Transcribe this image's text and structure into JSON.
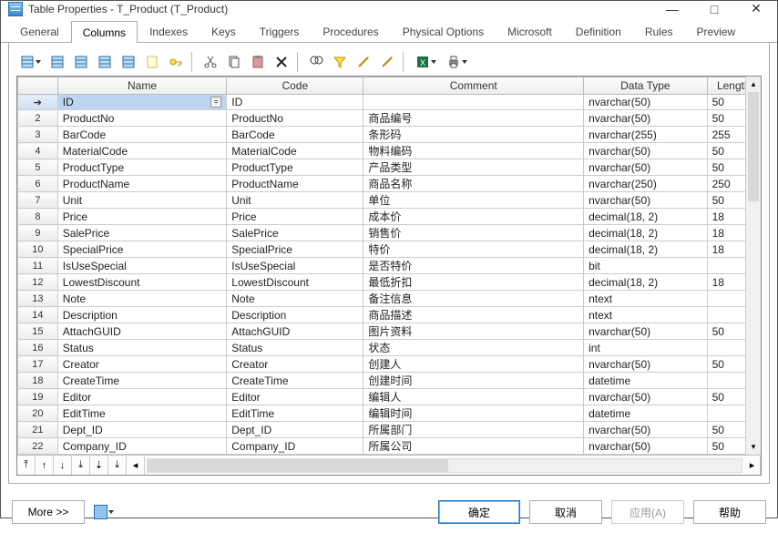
{
  "window": {
    "title": "Table Properties - T_Product (T_Product)"
  },
  "tabs": [
    {
      "label": "General",
      "active": false
    },
    {
      "label": "Columns",
      "active": true
    },
    {
      "label": "Indexes",
      "active": false
    },
    {
      "label": "Keys",
      "active": false
    },
    {
      "label": "Triggers",
      "active": false
    },
    {
      "label": "Procedures",
      "active": false
    },
    {
      "label": "Physical Options",
      "active": false
    },
    {
      "label": "Microsoft",
      "active": false
    },
    {
      "label": "Definition",
      "active": false
    },
    {
      "label": "Rules",
      "active": false
    },
    {
      "label": "Preview",
      "active": false
    }
  ],
  "columns": [
    {
      "label": "Name"
    },
    {
      "label": "Code"
    },
    {
      "label": "Comment"
    },
    {
      "label": "Data Type"
    },
    {
      "label": "Length"
    }
  ],
  "rows": [
    {
      "num": "",
      "rowhdr_arrow": true,
      "name": "ID",
      "code": "ID",
      "comment": "",
      "datatype": "nvarchar(50)",
      "length": "50",
      "selected": true,
      "edit_btn": true
    },
    {
      "num": "2",
      "name": "ProductNo",
      "code": "ProductNo",
      "comment": "商品编号",
      "datatype": "nvarchar(50)",
      "length": "50"
    },
    {
      "num": "3",
      "name": "BarCode",
      "code": "BarCode",
      "comment": "条形码",
      "datatype": "nvarchar(255)",
      "length": "255"
    },
    {
      "num": "4",
      "name": "MaterialCode",
      "code": "MaterialCode",
      "comment": "物料编码",
      "datatype": "nvarchar(50)",
      "length": "50"
    },
    {
      "num": "5",
      "name": "ProductType",
      "code": "ProductType",
      "comment": "产品类型",
      "datatype": "nvarchar(50)",
      "length": "50"
    },
    {
      "num": "6",
      "name": "ProductName",
      "code": "ProductName",
      "comment": "商品名称",
      "datatype": "nvarchar(250)",
      "length": "250"
    },
    {
      "num": "7",
      "name": "Unit",
      "code": "Unit",
      "comment": "单位",
      "datatype": "nvarchar(50)",
      "length": "50"
    },
    {
      "num": "8",
      "name": "Price",
      "code": "Price",
      "comment": "成本价",
      "datatype": "decimal(18, 2)",
      "length": "18"
    },
    {
      "num": "9",
      "name": "SalePrice",
      "code": "SalePrice",
      "comment": "销售价",
      "datatype": "decimal(18, 2)",
      "length": "18"
    },
    {
      "num": "10",
      "name": "SpecialPrice",
      "code": "SpecialPrice",
      "comment": "特价",
      "datatype": "decimal(18, 2)",
      "length": "18"
    },
    {
      "num": "11",
      "name": "IsUseSpecial",
      "code": "IsUseSpecial",
      "comment": "是否特价",
      "datatype": "bit",
      "length": ""
    },
    {
      "num": "12",
      "name": "LowestDiscount",
      "code": "LowestDiscount",
      "comment": "最低折扣",
      "datatype": "decimal(18, 2)",
      "length": "18"
    },
    {
      "num": "13",
      "name": "Note",
      "code": "Note",
      "comment": "备注信息",
      "datatype": "ntext",
      "length": ""
    },
    {
      "num": "14",
      "name": "Description",
      "code": "Description",
      "comment": "商品描述",
      "datatype": "ntext",
      "length": ""
    },
    {
      "num": "15",
      "name": "AttachGUID",
      "code": "AttachGUID",
      "comment": "图片资料",
      "datatype": "nvarchar(50)",
      "length": "50"
    },
    {
      "num": "16",
      "name": "Status",
      "code": "Status",
      "comment": "状态",
      "datatype": "int",
      "length": ""
    },
    {
      "num": "17",
      "name": "Creator",
      "code": "Creator",
      "comment": "创建人",
      "datatype": "nvarchar(50)",
      "length": "50"
    },
    {
      "num": "18",
      "name": "CreateTime",
      "code": "CreateTime",
      "comment": "创建时间",
      "datatype": "datetime",
      "length": ""
    },
    {
      "num": "19",
      "name": "Editor",
      "code": "Editor",
      "comment": "编辑人",
      "datatype": "nvarchar(50)",
      "length": "50"
    },
    {
      "num": "20",
      "name": "EditTime",
      "code": "EditTime",
      "comment": "编辑时间",
      "datatype": "datetime",
      "length": ""
    },
    {
      "num": "21",
      "name": "Dept_ID",
      "code": "Dept_ID",
      "comment": "所属部门",
      "datatype": "nvarchar(50)",
      "length": "50"
    },
    {
      "num": "22",
      "name": "Company_ID",
      "code": "Company_ID",
      "comment": "所属公司",
      "datatype": "nvarchar(50)",
      "length": "50"
    }
  ],
  "buttons": {
    "more": "More >>",
    "ok": "确定",
    "cancel": "取消",
    "apply": "应用(A)",
    "help": "帮助"
  },
  "toolbar_icons": [
    "insert-row-icon",
    "add-table-icon",
    "duplicate-icon",
    "grid-icon",
    "grid-add-icon",
    "note-icon",
    "key-icon",
    "|",
    "cut-icon",
    "copy-icon",
    "paste-icon",
    "delete-icon",
    "|",
    "find-icon",
    "filter-icon",
    "wand-icon",
    "wand2-icon",
    "|",
    "excel-icon",
    "print-icon"
  ]
}
